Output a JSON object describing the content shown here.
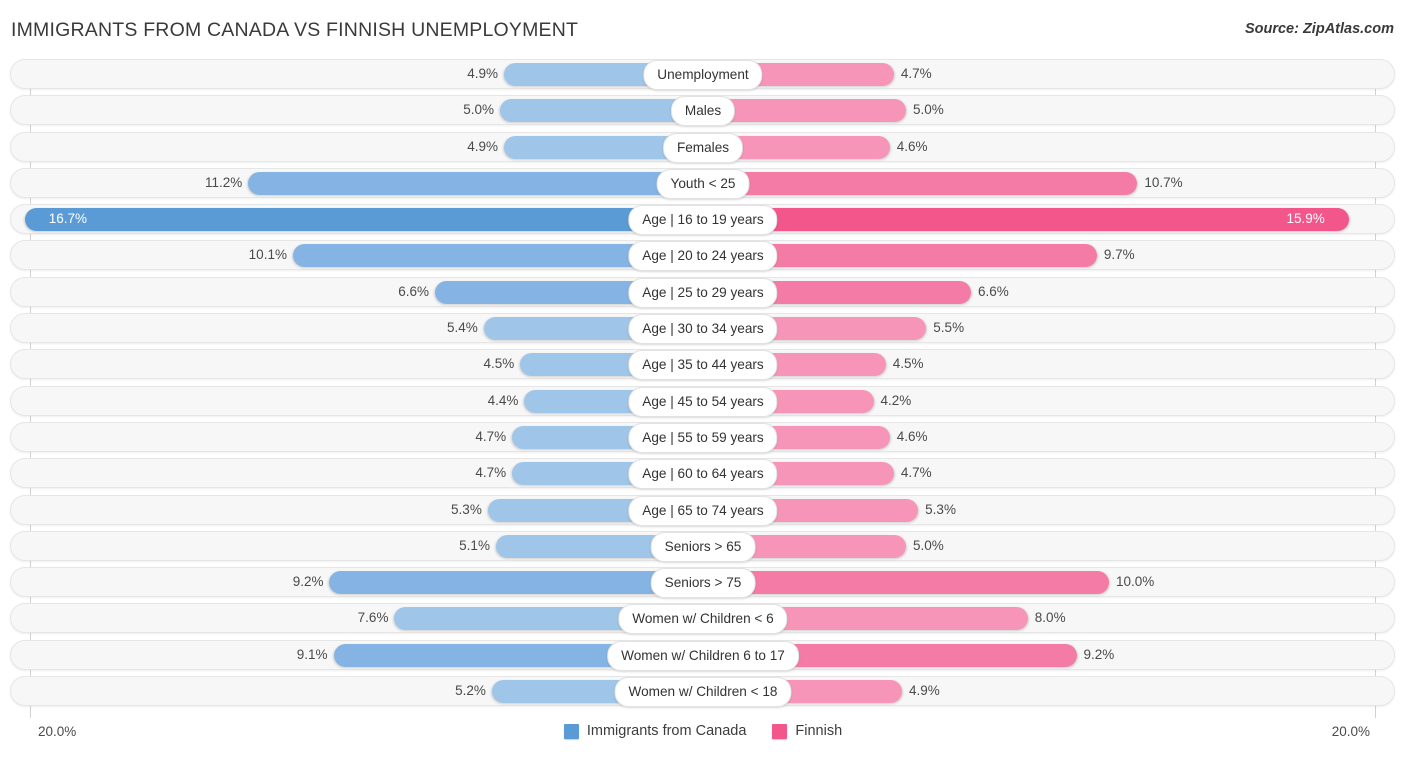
{
  "header": {
    "title": "IMMIGRANTS FROM CANADA VS FINNISH UNEMPLOYMENT",
    "source": "Source: ZipAtlas.com"
  },
  "axis": {
    "min_label": "20.0%",
    "max_label": "20.0%"
  },
  "legend": {
    "items": [
      {
        "label": "Immigrants from Canada",
        "color": "#5b9bd5",
        "icon": "square-swatch-icon"
      },
      {
        "label": "Finnish",
        "color": "#f3568b",
        "icon": "square-swatch-icon"
      }
    ]
  },
  "colors": {
    "left_light": "#9fc5e8",
    "left_dark": "#5b9bd5",
    "right_light": "#f795b8",
    "right_dark": "#f3568b",
    "track": "#f7f7f7",
    "gridline": "#d2d2d2"
  },
  "chart_data": {
    "type": "bar",
    "orientation": "horizontal-diverging",
    "title": "IMMIGRANTS FROM CANADA VS FINNISH UNEMPLOYMENT",
    "xlabel": "",
    "ylabel": "",
    "xlim": [
      20.0,
      20.0
    ],
    "axis_max_percent": 20.0,
    "grid": true,
    "legend_position": "bottom-center",
    "categories": [
      "Unemployment",
      "Males",
      "Females",
      "Youth < 25",
      "Age | 16 to 19 years",
      "Age | 20 to 24 years",
      "Age | 25 to 29 years",
      "Age | 30 to 34 years",
      "Age | 35 to 44 years",
      "Age | 45 to 54 years",
      "Age | 55 to 59 years",
      "Age | 60 to 64 years",
      "Age | 65 to 74 years",
      "Seniors > 65",
      "Seniors > 75",
      "Women w/ Children < 6",
      "Women w/ Children 6 to 17",
      "Women w/ Children < 18"
    ],
    "series": [
      {
        "name": "Immigrants from Canada",
        "color": "#5b9bd5",
        "values": [
          4.9,
          5.0,
          4.9,
          11.2,
          16.7,
          10.1,
          6.6,
          5.4,
          4.5,
          4.4,
          4.7,
          4.7,
          5.3,
          5.1,
          9.2,
          7.6,
          9.1,
          5.2
        ],
        "labels": [
          "4.9%",
          "5.0%",
          "4.9%",
          "11.2%",
          "16.7%",
          "10.1%",
          "6.6%",
          "5.4%",
          "4.5%",
          "4.4%",
          "4.7%",
          "4.7%",
          "5.3%",
          "5.1%",
          "9.2%",
          "7.6%",
          "9.1%",
          "5.2%"
        ]
      },
      {
        "name": "Finnish",
        "color": "#f3568b",
        "values": [
          4.7,
          5.0,
          4.6,
          10.7,
          15.9,
          9.7,
          6.6,
          5.5,
          4.5,
          4.2,
          4.6,
          4.7,
          5.3,
          5.0,
          10.0,
          8.0,
          9.2,
          4.9
        ],
        "labels": [
          "4.7%",
          "5.0%",
          "4.6%",
          "10.7%",
          "15.9%",
          "9.7%",
          "6.6%",
          "5.5%",
          "4.5%",
          "4.2%",
          "4.6%",
          "4.7%",
          "5.3%",
          "5.0%",
          "10.0%",
          "8.0%",
          "9.2%",
          "4.9%"
        ]
      }
    ],
    "row_emphasis": [
      "normal",
      "normal",
      "normal",
      "semi",
      "high",
      "semi",
      "semi",
      "normal",
      "normal",
      "normal",
      "normal",
      "normal",
      "normal",
      "normal",
      "semi",
      "normal",
      "semi",
      "normal"
    ]
  }
}
